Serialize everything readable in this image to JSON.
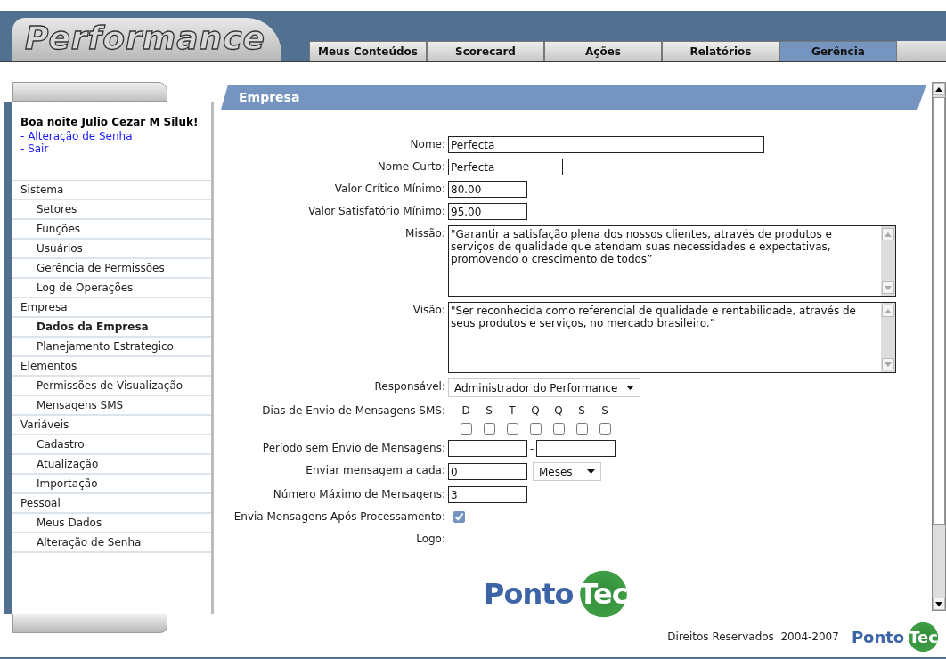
{
  "app_logo": "Performance",
  "tabs": [
    {
      "label": "Meus Conteúdos",
      "selected": false
    },
    {
      "label": "Scorecard",
      "selected": false
    },
    {
      "label": "Ações",
      "selected": false
    },
    {
      "label": "Relatórios",
      "selected": false
    },
    {
      "label": "Gerência",
      "selected": true
    }
  ],
  "sidebar": {
    "greeting": "Boa noite Julio Cezar M Siluk!",
    "links": [
      "- Alteração de Senha",
      "- Sair"
    ],
    "menu": [
      {
        "label": "Sistema",
        "children": [
          {
            "label": "Setores",
            "selected": false
          },
          {
            "label": "Funções",
            "selected": false
          },
          {
            "label": "Usuários",
            "selected": false
          },
          {
            "label": "Gerência de Permissões",
            "selected": false
          },
          {
            "label": "Log de Operações",
            "selected": false
          }
        ]
      },
      {
        "label": "Empresa",
        "children": [
          {
            "label": "Dados da Empresa",
            "selected": true
          },
          {
            "label": "Planejamento Estrategico",
            "selected": false
          }
        ]
      },
      {
        "label": "Elementos",
        "children": [
          {
            "label": "Permissões de Visualização",
            "selected": false
          },
          {
            "label": "Mensagens SMS",
            "selected": false
          }
        ]
      },
      {
        "label": "Variáveis",
        "children": [
          {
            "label": "Cadastro",
            "selected": false
          },
          {
            "label": "Atualização",
            "selected": false
          },
          {
            "label": "Importação",
            "selected": false
          }
        ]
      },
      {
        "label": "Pessoal",
        "children": [
          {
            "label": "Meus Dados",
            "selected": false
          },
          {
            "label": "Alteração de Senha",
            "selected": false
          }
        ]
      }
    ]
  },
  "section_title": "Empresa",
  "form": [
    {
      "kind": "text-wide",
      "label": "Nome:",
      "value": "Perfecta"
    },
    {
      "kind": "text-medium",
      "label": "Nome Curto:",
      "value": "Perfecta"
    },
    {
      "kind": "text",
      "label": "Valor Crítico Mínimo:",
      "value": "80.00"
    },
    {
      "kind": "text",
      "label": "Valor Satisfatório Mínimo:",
      "value": "95.00"
    },
    {
      "kind": "textarea",
      "label": "Missão:",
      "value": "\"Garantir a satisfação plena dos nossos clientes, através de produtos e serviços de qualidade que atendam suas necessidades e expectativas, promovendo o crescimento de todos”"
    },
    {
      "kind": "textarea",
      "label": "Visão:",
      "value": "\"Ser reconhecida como referencial de qualidade e rentabilidade, através de seus produtos e serviços, no mercado brasileiro.”"
    },
    {
      "kind": "select",
      "label": "Responsável:",
      "value": "Administrador do Performance"
    },
    {
      "kind": "weekdays",
      "label": "Dias de Envio de Mensagens SMS:",
      "days": [
        {
          "label": "D",
          "checked": false
        },
        {
          "label": "S",
          "checked": false
        },
        {
          "label": "T",
          "checked": false
        },
        {
          "label": "Q",
          "checked": false
        },
        {
          "label": "Q",
          "checked": false
        },
        {
          "label": "S",
          "checked": false
        },
        {
          "label": "S",
          "checked": false
        }
      ]
    },
    {
      "kind": "range",
      "label": "Período sem Envio de Mensagens:",
      "separator": "-"
    },
    {
      "kind": "number-unit",
      "label": "Enviar mensagem a cada:",
      "value": "0",
      "unit": "Meses"
    },
    {
      "kind": "text",
      "label": "Número Máximo de Mensagens:",
      "value": "3"
    },
    {
      "kind": "checkbox",
      "label": "Envia Mensagens Após Processamento:",
      "checked": true
    },
    {
      "kind": "logo",
      "label": "Logo:",
      "logo_main": "Ponto",
      "logo_accent": "Tec"
    }
  ],
  "footer": {
    "copyright": "Direitos Reservados  2004-2007",
    "logo_main": "Ponto",
    "logo_accent": "Tec"
  }
}
